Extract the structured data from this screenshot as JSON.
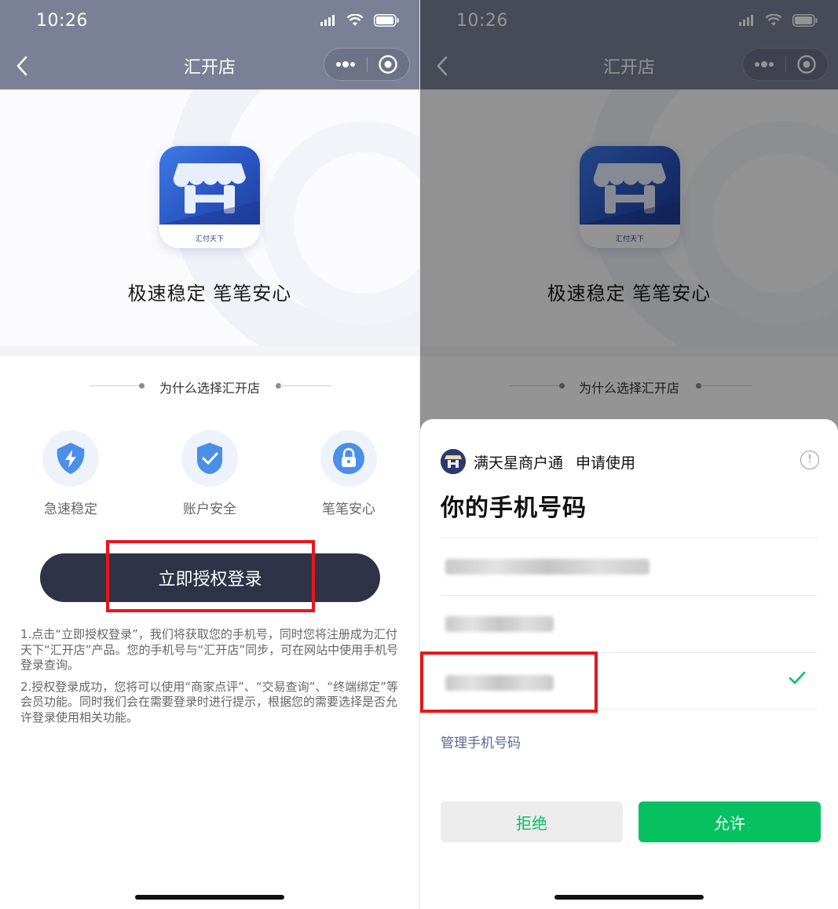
{
  "left": {
    "status_time": "10:26",
    "nav_title": "汇开店",
    "slogan": "极速稳定 笔笔安心",
    "logo_caption": "汇付天下",
    "why_title": "为什么选择汇开店",
    "features": [
      {
        "label": "急速稳定",
        "icon": "lightning-shield-icon"
      },
      {
        "label": "账户安全",
        "icon": "check-shield-icon"
      },
      {
        "label": "笔笔安心",
        "icon": "lock-icon"
      }
    ],
    "login_button": "立即授权登录",
    "notes": [
      "1.点击“立即授权登录”，我们将获取您的手机号，同时您将注册成为汇付天下“汇开店”产品。您的手机号与“汇开店”同步，可在网站中使用手机号登录查询。",
      "2.授权登录成功，您将可以使用“商家点评”、“交易查询”、“终端绑定”等会员功能。同时我们会在需要登录时进行提示，根据您的需要选择是否允许登录使用相关功能。"
    ]
  },
  "right": {
    "status_time": "10:26",
    "nav_title": "汇开店",
    "slogan": "极速稳定 笔笔安心",
    "logo_caption": "汇付天下",
    "why_title": "为什么选择汇开店",
    "sheet": {
      "app_name": "满天星商户通",
      "request": "申请使用",
      "info_symbol": "!",
      "title": "你的手机号码",
      "phones": [
        {
          "selected": false
        },
        {
          "selected": false
        },
        {
          "selected": true
        }
      ],
      "manage_link": "管理手机号码",
      "reject_button": "拒绝",
      "allow_button": "允许"
    }
  },
  "colors": {
    "nav_bg": "#7a8197",
    "login_btn": "#2f3347",
    "highlight": "#e8161b",
    "wechat_green": "#07c160",
    "link_blue": "#576b95"
  }
}
